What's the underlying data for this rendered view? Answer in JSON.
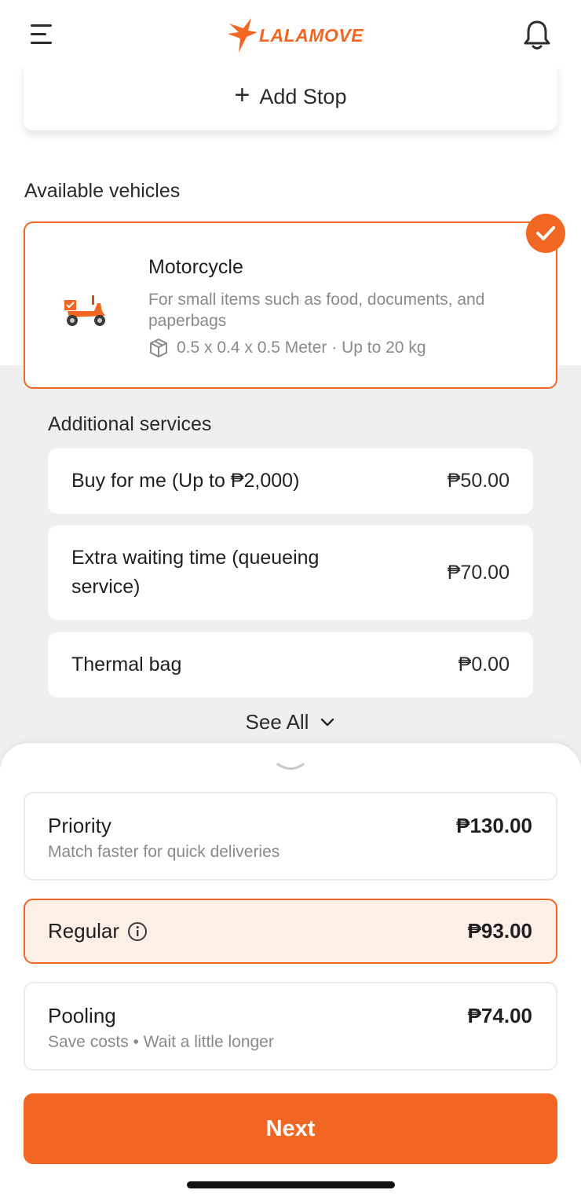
{
  "header": {
    "brand": "LALAMOVE",
    "menu_icon": "hamburger-menu-icon",
    "notification_icon": "bell-icon"
  },
  "add_stop": {
    "label": "Add Stop",
    "icon": "plus-icon"
  },
  "vehicles": {
    "section_title": "Available vehicles",
    "selected": {
      "name": "Motorcycle",
      "description": "For small items such as food, documents, and paperbags",
      "spec": "0.5 x 0.4 x 0.5 Meter · Up to 20 kg",
      "icon": "motorcycle-icon",
      "spec_icon": "box-icon",
      "check_icon": "checkmark-icon"
    }
  },
  "additional_services": {
    "title": "Additional services",
    "items": [
      {
        "label": "Buy for me (Up to ₱2,000)",
        "price": "₱50.00"
      },
      {
        "label": "Extra waiting time (queueing service)",
        "price": "₱70.00"
      },
      {
        "label": "Thermal bag",
        "price": "₱0.00"
      }
    ],
    "see_all": "See All"
  },
  "delivery_options": [
    {
      "title": "Priority",
      "subtitle": "Match faster for quick deliveries",
      "price": "₱130.00",
      "selected": false
    },
    {
      "title": "Regular",
      "subtitle": "",
      "price": "₱93.00",
      "selected": true,
      "info_icon": "info-icon"
    },
    {
      "title": "Pooling",
      "subtitle": "Save costs • Wait a little longer",
      "price": "₱74.00",
      "selected": false
    }
  ],
  "next_button": {
    "label": "Next"
  },
  "colors": {
    "accent": "#f16622",
    "selected_bg": "#fdeee6",
    "page_grey": "#efefef"
  }
}
